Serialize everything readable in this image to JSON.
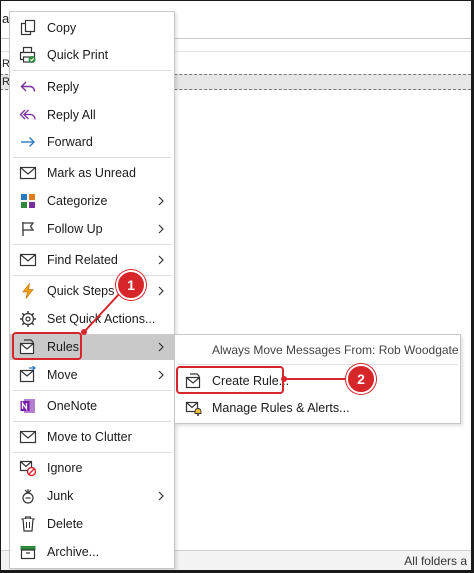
{
  "background": {
    "top_letter": "a",
    "row_letters": [
      "R",
      "R"
    ],
    "status_text": "All folders a"
  },
  "menu": {
    "items": [
      {
        "label": "Copy",
        "icon": "copy-icon"
      },
      {
        "label": "Quick Print",
        "icon": "quick-print-icon"
      },
      {
        "label": "Reply",
        "icon": "reply-icon"
      },
      {
        "label": "Reply All",
        "icon": "reply-all-icon"
      },
      {
        "label": "Forward",
        "icon": "forward-icon"
      },
      {
        "label": "Mark as Unread",
        "icon": "envelope-icon"
      },
      {
        "label": "Categorize",
        "icon": "categorize-icon",
        "submenu": true
      },
      {
        "label": "Follow Up",
        "icon": "flag-icon",
        "submenu": true
      },
      {
        "label": "Find Related",
        "icon": "find-related-icon",
        "submenu": true
      },
      {
        "label": "Quick Steps",
        "icon": "lightning-icon",
        "submenu": true
      },
      {
        "label": "Set Quick Actions...",
        "icon": "gear-icon"
      },
      {
        "label": "Rules",
        "icon": "rules-icon",
        "submenu": true,
        "highlighted": true
      },
      {
        "label": "Move",
        "icon": "move-icon",
        "submenu": true
      },
      {
        "label": "OneNote",
        "icon": "onenote-icon"
      },
      {
        "label": "Move to Clutter",
        "icon": "clutter-icon"
      },
      {
        "label": "Ignore",
        "icon": "ignore-icon"
      },
      {
        "label": "Junk",
        "icon": "junk-icon",
        "submenu": true
      },
      {
        "label": "Delete",
        "icon": "trash-icon"
      },
      {
        "label": "Archive...",
        "icon": "archive-icon"
      }
    ]
  },
  "submenu": {
    "header": "Always Move Messages From: Rob Woodgate",
    "items": [
      {
        "label": "Create Rule...",
        "icon": "create-rule-icon"
      },
      {
        "label": "Manage Rules & Alerts...",
        "icon": "manage-rules-icon"
      }
    ]
  },
  "callouts": {
    "step1": "1",
    "step2": "2"
  },
  "colors": {
    "callout": "#d6262a",
    "highlight": "#c9c9c9",
    "icon_blue": "#2b79c2",
    "icon_purple": "#7a2fa0",
    "icon_orange": "#e07b1a"
  }
}
